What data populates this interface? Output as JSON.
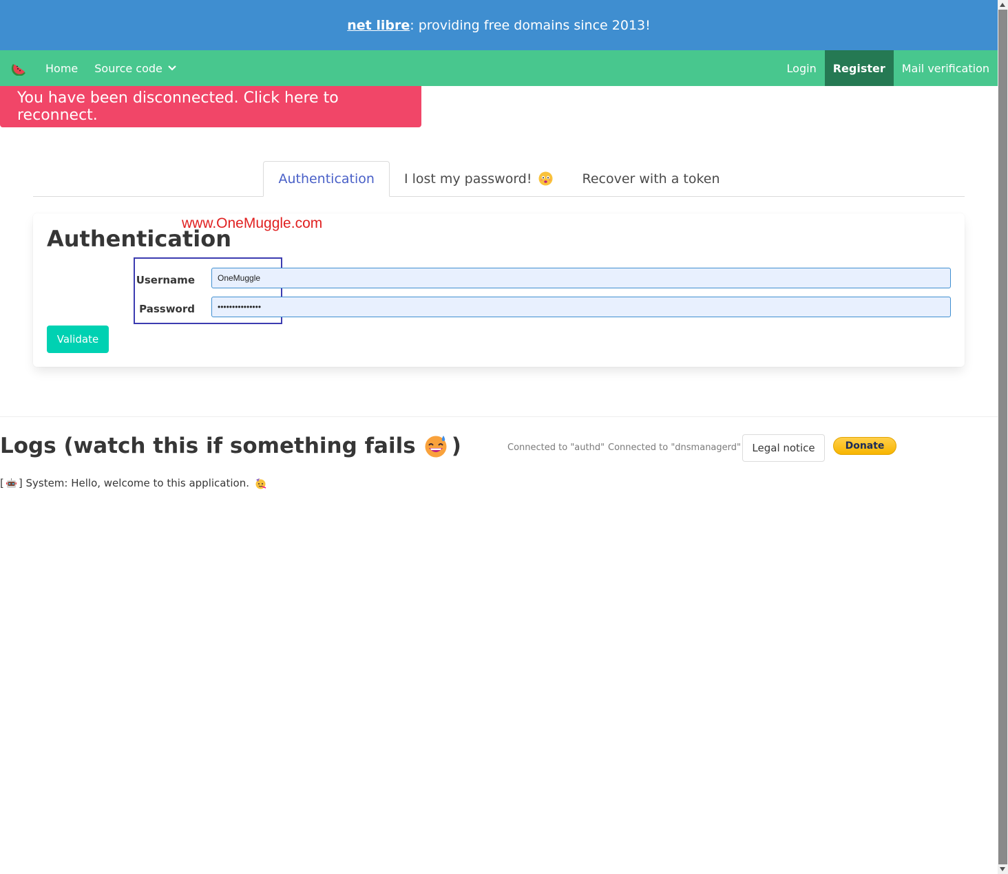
{
  "banner": {
    "link_text": "net libre",
    "tagline": ": providing free domains since 2013!"
  },
  "navbar": {
    "logo_icon": "watermelon-icon",
    "home": "Home",
    "source_code": "Source code",
    "login": "Login",
    "register": "Register",
    "mail_verification": "Mail verification"
  },
  "notice": {
    "disconnected": "You have been disconnected. Click here to reconnect."
  },
  "tabs": [
    {
      "label": "Authentication",
      "active": true
    },
    {
      "label": "I lost my password!",
      "icon": "worried-face-icon"
    },
    {
      "label": "Recover with a token"
    }
  ],
  "auth_card": {
    "title": "Authentication",
    "watermark": "www.OneMuggle.com",
    "username_label": "Username",
    "username_value": "OneMuggle",
    "password_label": "Password",
    "password_value": "•••••••••••••••",
    "validate_label": "Validate"
  },
  "logs": {
    "title": "Logs (watch this if something fails",
    "title_end": ")",
    "title_icon": "grinning-sweat-face-icon",
    "status_authd": "Connected to \"authd\"",
    "status_dnsmanagerd": "Connected to \"dnsmanagerd\"",
    "legal_notice": "Legal notice",
    "donate": "Donate",
    "entries": [
      {
        "prefix": "[",
        "icon": "robot-icon",
        "text": "] System: Hello, welcome to this application.",
        "trail_icon": "party-face-icon"
      }
    ]
  },
  "colors": {
    "banner": "#3f8ed0",
    "navbar": "#48c78e",
    "navbar_active": "#257953",
    "danger": "#f14668",
    "primary_button": "#00d1b2",
    "tab_active": "#485fc7"
  }
}
